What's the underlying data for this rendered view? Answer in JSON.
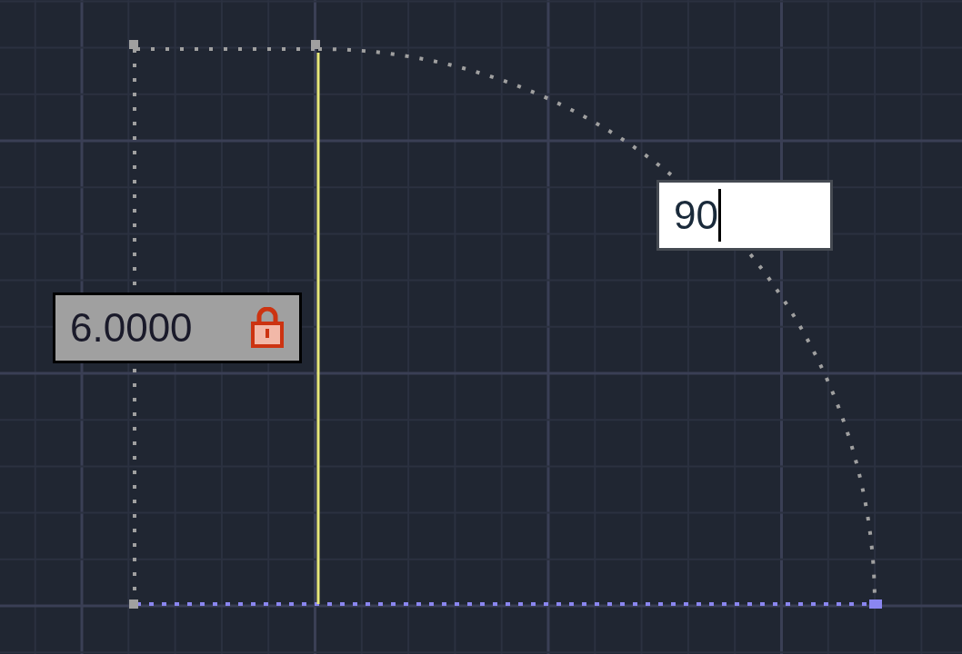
{
  "dimension_field": {
    "value": "6.0000",
    "locked": true
  },
  "angle_field": {
    "value": "90",
    "editing": true
  }
}
